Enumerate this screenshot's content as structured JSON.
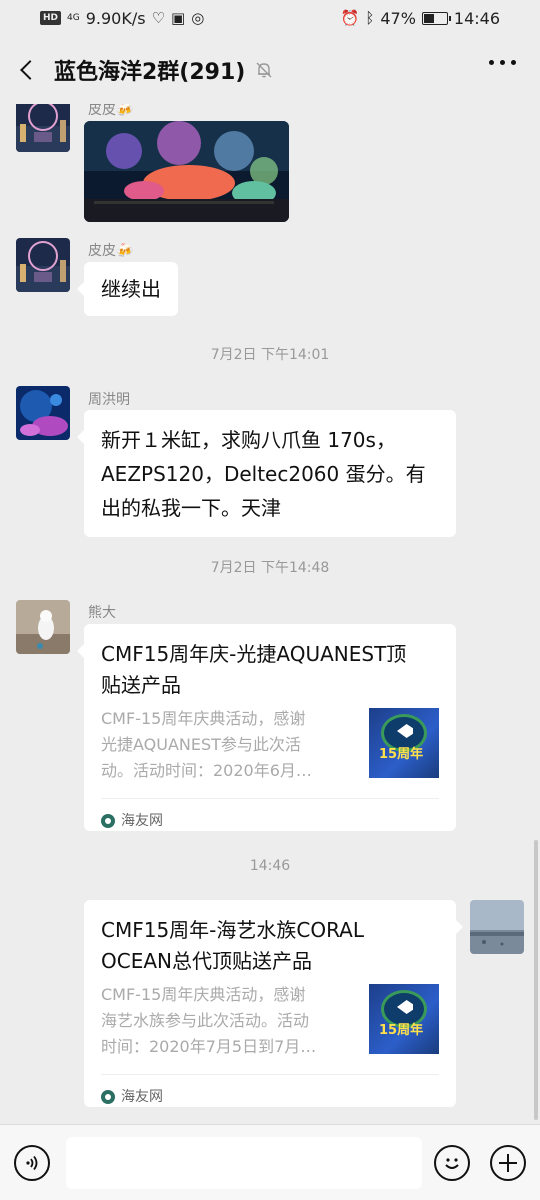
{
  "status_bar": {
    "network_badge": "HD",
    "signal_type": "4G",
    "speed": "9.90K/s",
    "battery": "47%",
    "battery_level": 0.47,
    "time": "14:46"
  },
  "header": {
    "title": "蓝色海洋2群(291)",
    "muted": true
  },
  "messages": [
    {
      "type": "image",
      "sender": "皮皮🍻",
      "side": "left"
    },
    {
      "type": "text",
      "sender": "皮皮🍻",
      "side": "left",
      "text": "继续出"
    },
    {
      "type": "time",
      "text": "7月2日 下午14:01"
    },
    {
      "type": "text",
      "sender": "周洪明",
      "side": "left",
      "lines": [
        "新开１米缸，求购八爪鱼 170s，",
        "AEZPS120，Deltec2060 蛋分。有",
        "出的私我一下。天津"
      ]
    },
    {
      "type": "time",
      "text": "7月2日 下午14:48"
    },
    {
      "type": "card",
      "sender": "熊大",
      "side": "left",
      "title_lines": [
        "CMF15周年庆-光捷AQUANEST顶",
        "贴送产品"
      ],
      "desc_lines": [
        "CMF-15周年庆典活动，感谢",
        "光捷AQUANEST参与此次活",
        "动。活动时间：2020年6月…"
      ],
      "thumb_label": "15周年",
      "source": "海友网"
    },
    {
      "type": "time",
      "text": "14:46"
    },
    {
      "type": "card",
      "side": "right",
      "title_lines": [
        "CMF15周年-海艺水族CORAL",
        "OCEAN总代顶贴送产品"
      ],
      "desc_lines": [
        "CMF-15周年庆典活动，感谢",
        "海艺水族参与此次活动。活动",
        "时间：2020年7月5日到7月…"
      ],
      "thumb_label": "15周年",
      "source": "海友网"
    }
  ],
  "input_bar": {
    "placeholder": ""
  }
}
